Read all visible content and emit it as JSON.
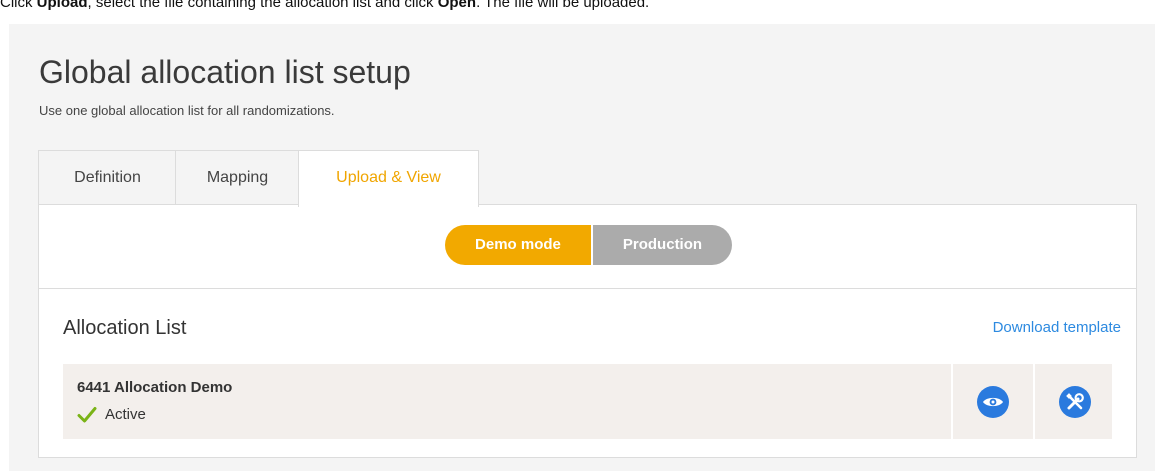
{
  "instruction": {
    "part1": "Click ",
    "upload": "Upload",
    "part2": ", select the file containing the allocation list and click ",
    "open": "Open",
    "part3": ". The file will be uploaded."
  },
  "page": {
    "title": "Global allocation list setup",
    "subtitle": "Use one global allocation list for all randomizations."
  },
  "tabs": [
    {
      "label": "Definition",
      "active": false
    },
    {
      "label": "Mapping",
      "active": false
    },
    {
      "label": "Upload & View",
      "active": true
    }
  ],
  "mode_toggle": {
    "demo_label": "Demo mode",
    "production_label": "Production",
    "selected": "Demo mode"
  },
  "allocation_list": {
    "title": "Allocation List",
    "download_label": "Download template",
    "rows": [
      {
        "name": "6441 Allocation Demo",
        "status": "Active"
      }
    ],
    "actions": [
      "eye-icon",
      "tools-icon"
    ]
  },
  "colors": {
    "accent": "#f2a900",
    "active_tab_text": "#f0a500",
    "link": "#2d8ae0",
    "action_button": "#2a7ade",
    "inactive_toggle": "#ababab",
    "status_check": "#7ab317",
    "row_background": "#f3efec"
  }
}
